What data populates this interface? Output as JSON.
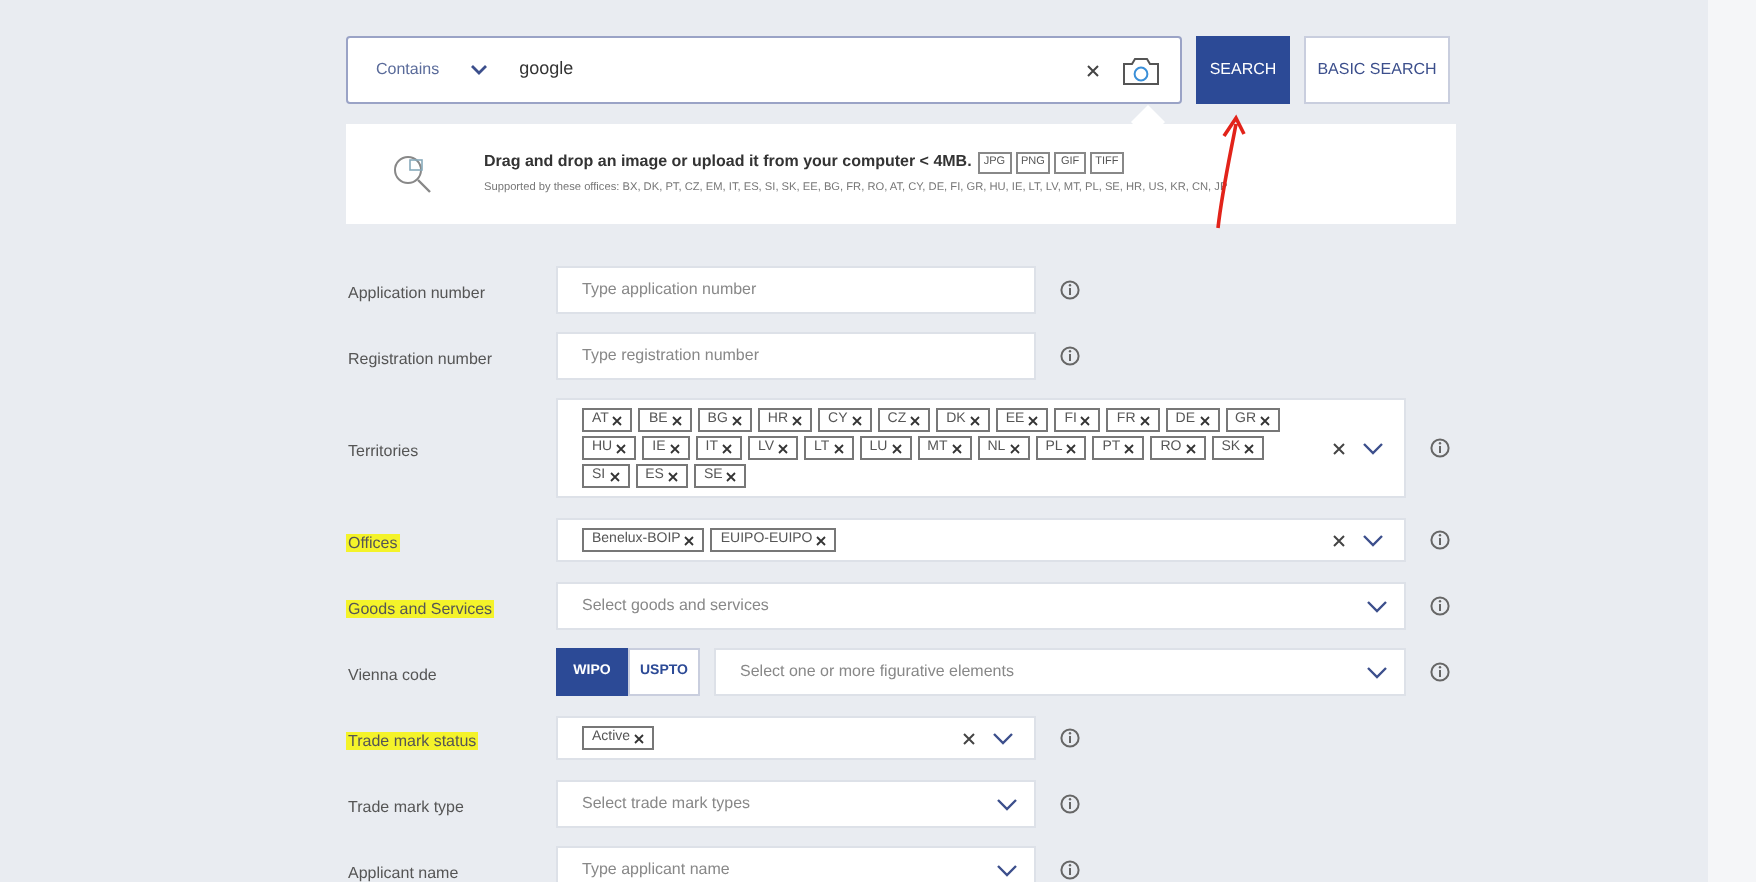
{
  "search_bar": {
    "mode": "Contains",
    "query": "google",
    "search_button": "SEARCH",
    "basic_search_button": "BASIC SEARCH"
  },
  "upload_panel": {
    "title": "Drag and drop an image or upload it from your computer < 4MB.",
    "formats": [
      "JPG",
      "PNG",
      "GIF",
      "TIFF"
    ],
    "supported": "Supported by these offices: BX, DK, PT, CZ, EM, IT, ES, SI, SK, EE, BG, FR, RO, AT, CY, DE, FI, GR, HU, IE, LT, LV, MT, PL, SE, HR, US, KR, CN, JP"
  },
  "fields": [
    {
      "kind": "text",
      "label": "Application number",
      "highlighted": false,
      "placeholder": "Type application number"
    },
    {
      "kind": "text",
      "label": "Registration number",
      "highlighted": false,
      "placeholder": "Type registration number"
    },
    {
      "kind": "multiselect",
      "label": "Territories",
      "highlighted": false,
      "chips": [
        "AT",
        "BE",
        "BG",
        "HR",
        "CY",
        "CZ",
        "DK",
        "EE",
        "FI",
        "FR",
        "DE",
        "GR",
        "HU",
        "IE",
        "IT",
        "LV",
        "LT",
        "LU",
        "MT",
        "NL",
        "PL",
        "PT",
        "RO",
        "SK",
        "SI",
        "ES",
        "SE"
      ]
    },
    {
      "kind": "multiselect",
      "label": "Offices",
      "highlighted": true,
      "chips": [
        "Benelux-BOIP",
        "EUIPO-EUIPO"
      ]
    },
    {
      "kind": "select",
      "label": "Goods and Services",
      "highlighted": true,
      "placeholder": "Select goods and services"
    },
    {
      "kind": "vienna",
      "label": "Vienna code",
      "highlighted": false,
      "options": [
        {
          "label": "WIPO",
          "selected": true
        },
        {
          "label": "USPTO",
          "selected": false
        }
      ],
      "placeholder": "Select one or more figurative elements"
    },
    {
      "kind": "multiselect",
      "label": "Trade mark status",
      "highlighted": true,
      "chips": [
        "Active"
      ]
    },
    {
      "kind": "select",
      "label": "Trade mark type",
      "highlighted": false,
      "placeholder": "Select trade mark types"
    },
    {
      "kind": "select",
      "label": "Applicant name",
      "highlighted": false,
      "placeholder": "Type applicant name"
    }
  ]
}
